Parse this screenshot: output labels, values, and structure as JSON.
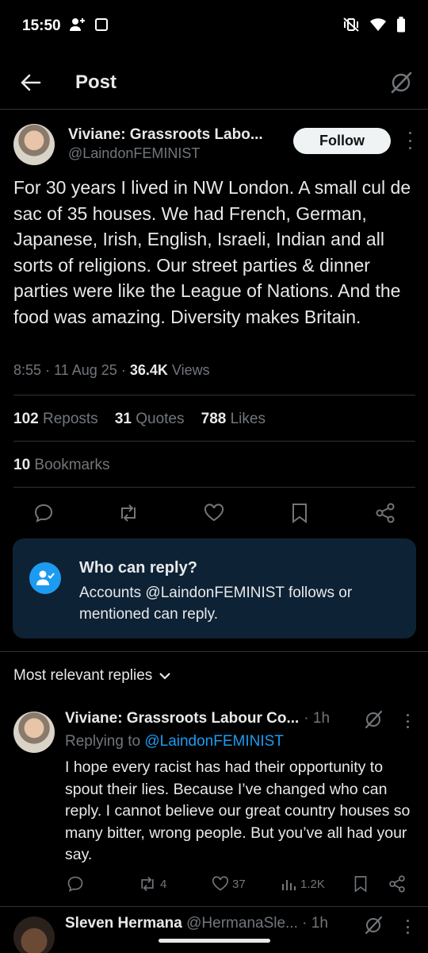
{
  "status_bar": {
    "time": "15:50"
  },
  "header": {
    "title": "Post"
  },
  "post": {
    "author_name": "Viviane: Grassroots Labo...",
    "author_handle": "@LaindonFEMINIST",
    "follow_label": "Follow",
    "text": "For 30 years I lived in NW London. A small cul de sac of 35 houses. We had French, German, Japanese, Irish, English, Israeli, Indian and all sorts of religions. Our street parties & dinner parties were like the League of Nations. And the food was amazing. Diversity makes Britain.",
    "time": "8:55",
    "date": "11 Aug 25",
    "views_count": "36.4K",
    "views_label": "Views",
    "reposts_count": "102",
    "reposts_label": "Reposts",
    "quotes_count": "31",
    "quotes_label": "Quotes",
    "likes_count": "788",
    "likes_label": "Likes",
    "bookmarks_count": "10",
    "bookmarks_label": "Bookmarks"
  },
  "who_can_reply": {
    "title": "Who can reply?",
    "description": "Accounts @LaindonFEMINIST follows or mentioned can reply."
  },
  "replies": {
    "sort_label": "Most relevant replies",
    "items": [
      {
        "author_name": "Viviane: Grassroots Labour Co...",
        "time": "· 1h",
        "replying_prefix": "Replying to",
        "replying_to": "@LaindonFEMINIST",
        "text": "I hope every racist has had their opportunity to spout their lies. Because I’ve changed who can reply. I cannot believe our great country houses so many bitter, wrong people. But you’ve all had your say.",
        "reposts": "4",
        "likes": "37",
        "views": "1.2K"
      },
      {
        "author_name": "Sleven Hermana",
        "author_handle": "@HermanaSle...",
        "time": "· 1h"
      }
    ]
  },
  "colors": {
    "background": "#000000",
    "accent": "#1d9bf0",
    "muted": "#71767b",
    "card": "#0e2235"
  }
}
